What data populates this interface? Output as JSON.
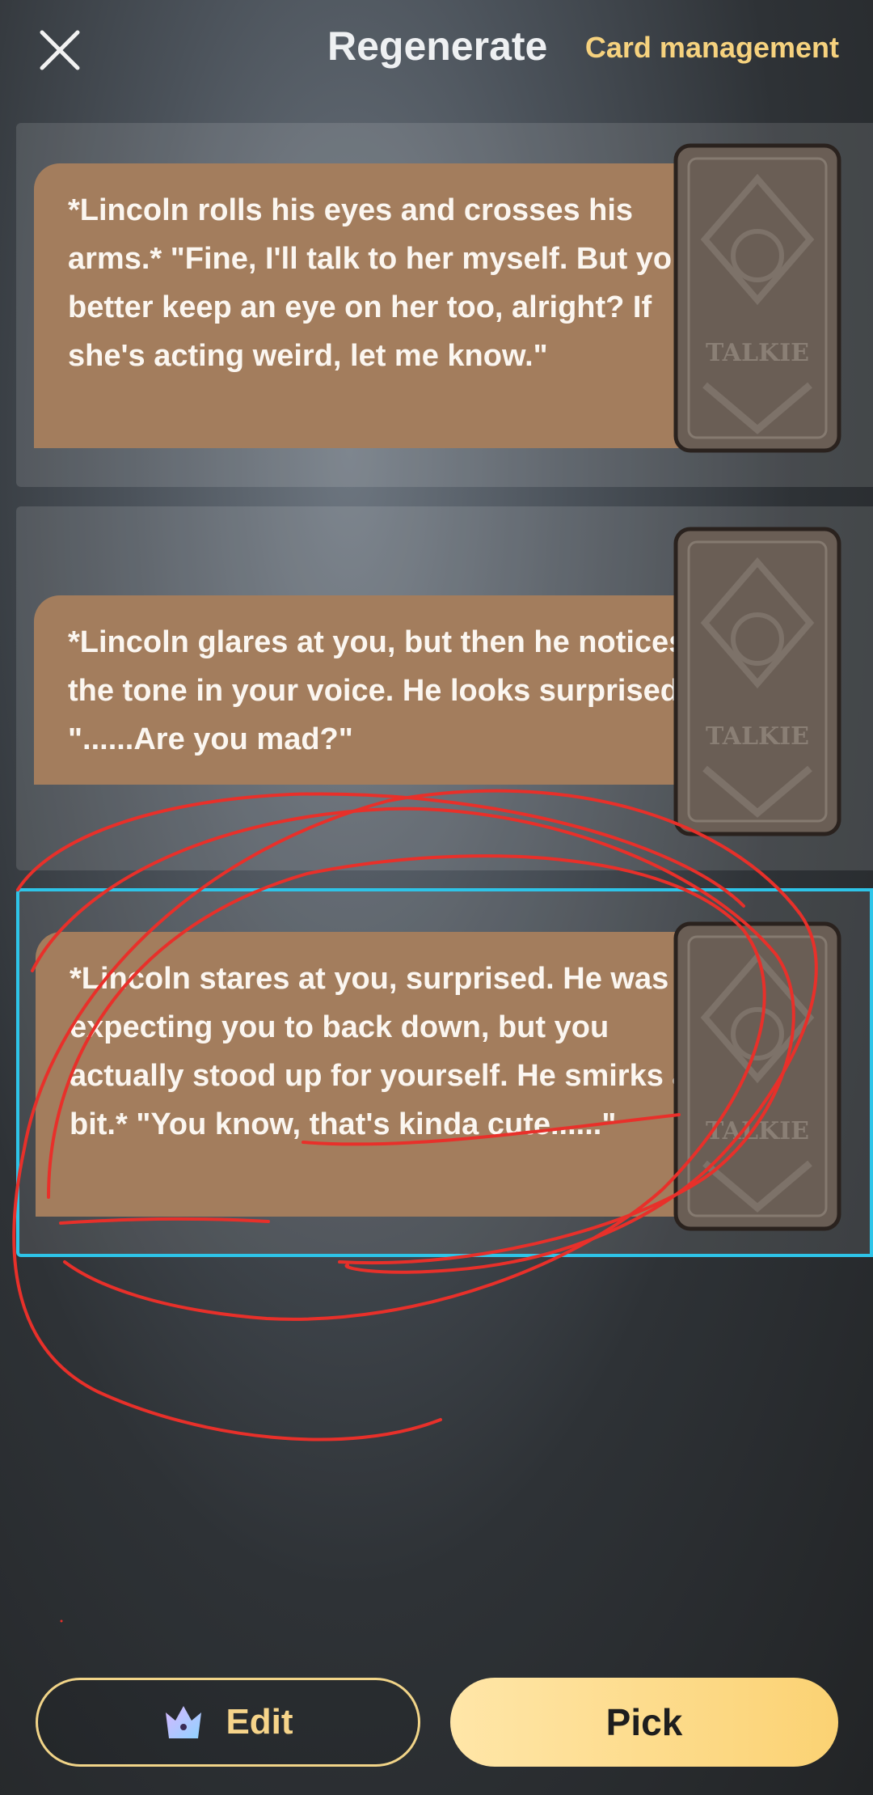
{
  "header": {
    "title": "Regenerate",
    "card_management": "Card management",
    "close_icon": "close-icon"
  },
  "options": [
    {
      "text": "*Lincoln rolls his eyes and crosses his arms.* \"Fine, I'll talk to her myself. But you better keep an eye on her too, alright? If she's acting weird, let me know.\"",
      "selected": false,
      "card_logo": "TALKIE"
    },
    {
      "text": "*Lincoln glares at you, but then he notices the tone in your voice. He looks surprised.* \"......Are you mad?\"",
      "selected": false,
      "card_logo": "TALKIE"
    },
    {
      "text": "*Lincoln stares at you, surprised. He was expecting you to back down, but you actually stood up for yourself. He smirks a bit.* \"You know, that's kinda cute......\"",
      "selected": true,
      "card_logo": "TALKIE"
    }
  ],
  "actions": {
    "edit_label": "Edit",
    "edit_icon": "crown-icon",
    "pick_label": "Pick"
  },
  "colors": {
    "accent_gold": "#f6d27e",
    "bubble": "#a37d5d",
    "selected_border": "#2ec4e8",
    "annotation_red": "#e8302a"
  }
}
